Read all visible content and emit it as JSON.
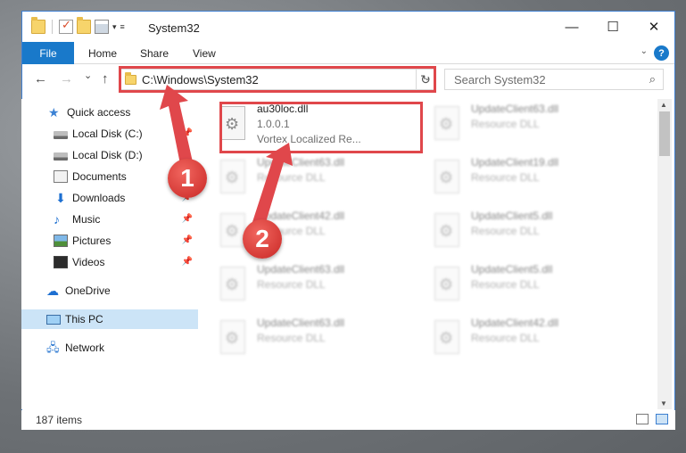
{
  "window": {
    "title": "System32",
    "controls": {
      "minimize": "—",
      "maximize": "☐",
      "close": "✕"
    }
  },
  "ribbon": {
    "file": "File",
    "tabs": [
      "Home",
      "Share",
      "View"
    ],
    "help": "?"
  },
  "nav": {
    "back": "←",
    "forward": "→",
    "recent": "⌄",
    "up": "↑",
    "address": "C:\\Windows\\System32",
    "refresh": "↻",
    "search_placeholder": "Search System32",
    "search_icon": "⌕"
  },
  "sidebar": {
    "items": [
      {
        "label": "Quick access",
        "icon": "star-icon"
      },
      {
        "label": "Local Disk (C:)",
        "icon": "drive-icon"
      },
      {
        "label": "Local Disk (D:)",
        "icon": "drive-icon"
      },
      {
        "label": "Documents",
        "icon": "documents-icon"
      },
      {
        "label": "Downloads",
        "icon": "downloads-icon"
      },
      {
        "label": "Music",
        "icon": "music-icon"
      },
      {
        "label": "Pictures",
        "icon": "pictures-icon"
      },
      {
        "label": "Videos",
        "icon": "videos-icon"
      },
      {
        "label": "OneDrive",
        "icon": "onedrive-icon"
      },
      {
        "label": "This PC",
        "icon": "computer-icon"
      },
      {
        "label": "Network",
        "icon": "network-icon"
      }
    ]
  },
  "files": [
    {
      "name": "au30loc.dll",
      "sub": "1.0.0.1",
      "desc": "Vortex Localized Re..."
    },
    {
      "name": "UpdateClient63.dll",
      "sub": "Resource DLL"
    },
    {
      "name": "UpdateClient63.dll",
      "sub": "Resource DLL"
    },
    {
      "name": "UpdateClient19.dll",
      "sub": "Resource DLL"
    },
    {
      "name": "UpdateClient42.dll",
      "sub": "Resource DLL"
    },
    {
      "name": "UpdateClient5.dll",
      "sub": "Resource DLL"
    },
    {
      "name": "UpdateClient63.dll",
      "sub": "Resource DLL"
    },
    {
      "name": "UpdateClient5.dll",
      "sub": "Resource DLL"
    },
    {
      "name": "UpdateClient63.dll",
      "sub": "Resource DLL"
    },
    {
      "name": "UpdateClient42.dll",
      "sub": "Resource DLL"
    }
  ],
  "status": {
    "count": "187 items"
  },
  "annotations": {
    "step1": "1",
    "step2": "2",
    "color": "#e0474b"
  }
}
